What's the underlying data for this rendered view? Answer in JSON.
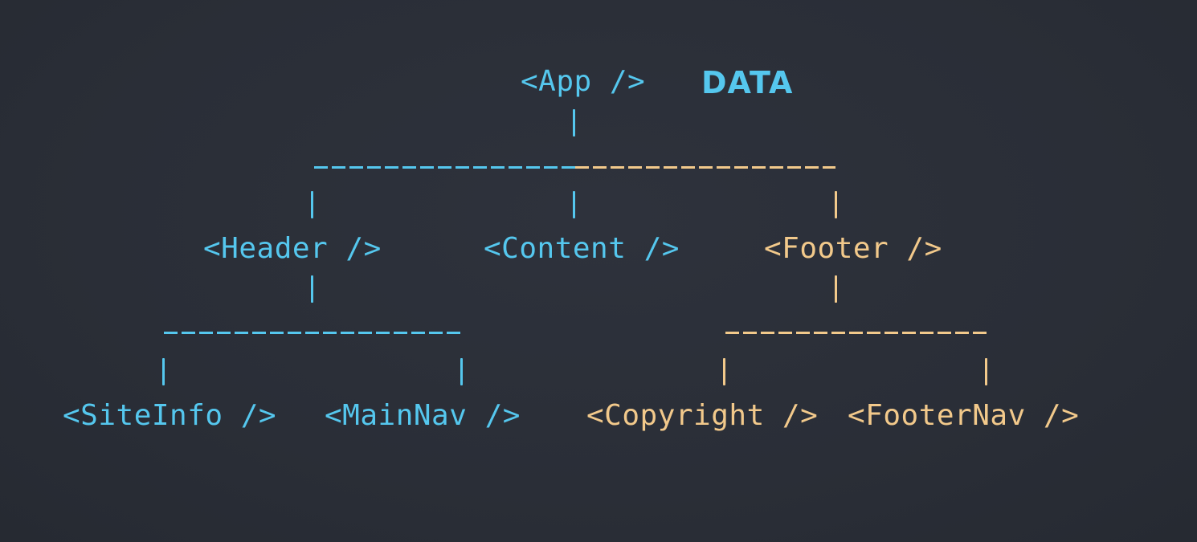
{
  "diagram": {
    "data_label": "DATA",
    "root": {
      "label": "<App />"
    },
    "level1": [
      {
        "label": "<Header />"
      },
      {
        "label": "<Content />"
      },
      {
        "label": "<Footer />"
      }
    ],
    "level2": [
      {
        "label": "<SiteInfo />"
      },
      {
        "label": "<MainNav />"
      },
      {
        "label": "<Copyright />"
      },
      {
        "label": "<FooterNav />"
      }
    ],
    "colors": {
      "background": "#2a2e37",
      "data_flow_blue": "#55c7ee",
      "footer_orange": "#f2c98b"
    }
  }
}
